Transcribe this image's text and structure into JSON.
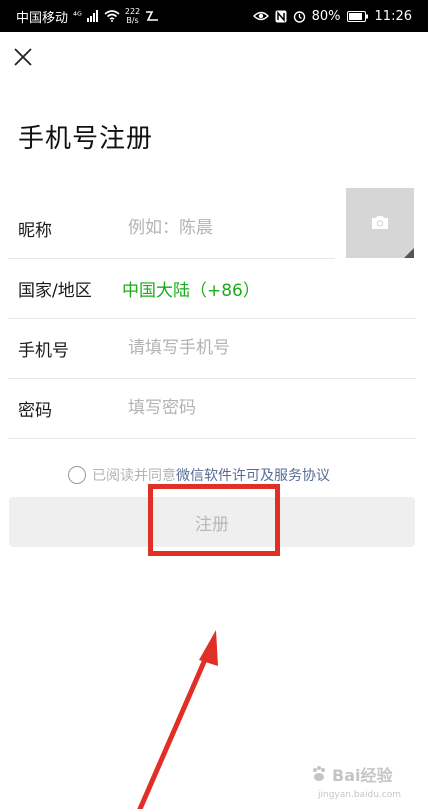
{
  "status_bar": {
    "carrier": "中国移动",
    "signal_text": "⁴ᴳ",
    "net_speed_value": "222",
    "net_speed_unit": "B/s",
    "battery": "80%",
    "time": "11:26"
  },
  "header": {
    "title": "手机号注册"
  },
  "form": {
    "nickname": {
      "label": "昵称",
      "placeholder": "例如：陈晨"
    },
    "region": {
      "label": "国家/地区",
      "value": "中国大陆（+86）"
    },
    "phone": {
      "label": "手机号",
      "placeholder": "请填写手机号"
    },
    "password": {
      "label": "密码",
      "placeholder": "填写密码"
    }
  },
  "agreement": {
    "prefix": "已阅读并同意",
    "link": "微信软件许可及服务协议"
  },
  "register_button": {
    "label": "注册"
  },
  "watermark": {
    "text": "Bai经验",
    "sub": "jingyan.baidu.com"
  },
  "colors": {
    "accent_green": "#1aad19",
    "link_blue": "#576b95",
    "annotation_red": "#e02f27"
  }
}
